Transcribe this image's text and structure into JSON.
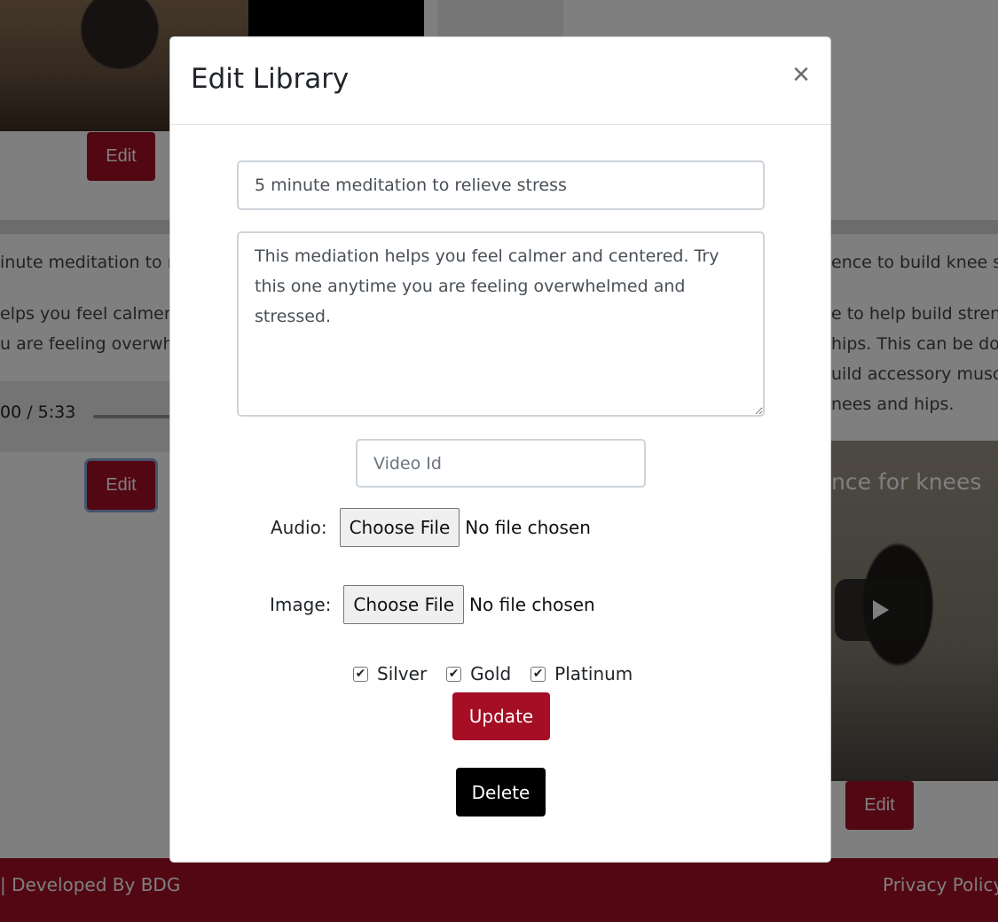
{
  "background": {
    "edit_label": "Edit",
    "left_card": {
      "title": "inute meditation to r",
      "desc_line1": "elps you feel calmer",
      "desc_line2": "u are feeling overwh",
      "audio_time": "00 / 5:33"
    },
    "right_card": {
      "title": "ence to build knee st",
      "desc_line1": "e to help build streng",
      "desc_line2": "hips. This can be do",
      "desc_line3": "uild accessory musc",
      "desc_line4": "nees and hips.",
      "video_title": "nce for knees"
    },
    "footer": {
      "left": "| Developed By BDG",
      "right": "Privacy Policy"
    }
  },
  "modal": {
    "title": "Edit Library",
    "close": "×",
    "title_value": "5 minute meditation to relieve stress",
    "description_value": "This mediation helps you feel calmer and centered. Try this one anytime you are feeling overwhelmed and stressed.",
    "video_id_placeholder": "Video Id",
    "audio": {
      "label": "Audio:",
      "button": "Choose File",
      "status": "No file chosen"
    },
    "image": {
      "label": "Image:",
      "button": "Choose File",
      "status": "No file chosen"
    },
    "tiers": [
      {
        "label": "Silver",
        "checked": true
      },
      {
        "label": "Gold",
        "checked": true
      },
      {
        "label": "Platinum",
        "checked": true
      }
    ],
    "update_label": "Update",
    "delete_label": "Delete"
  },
  "colors": {
    "brand": "#a50e24",
    "backdrop": "rgba(0,0,0,0.5)"
  }
}
